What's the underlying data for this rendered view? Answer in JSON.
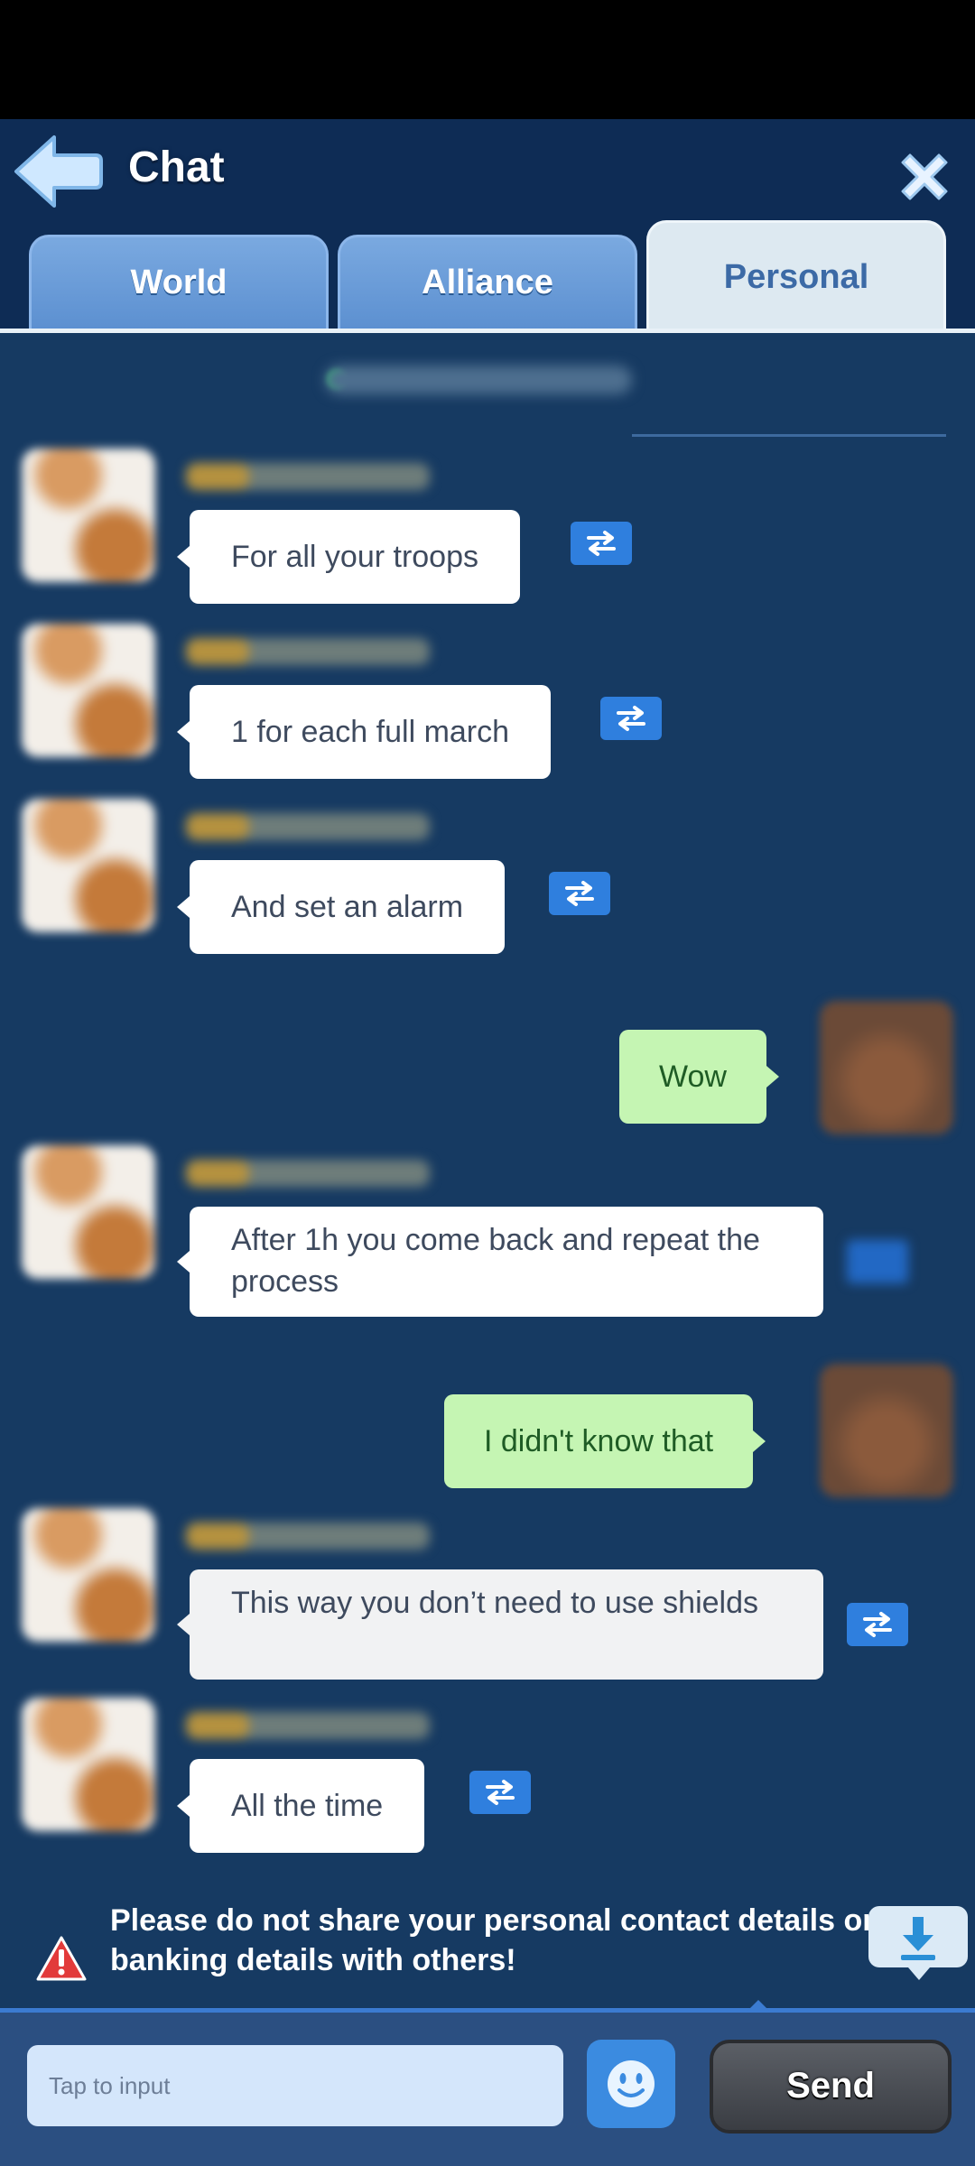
{
  "header": {
    "title": "Chat",
    "back_icon": "arrow-left-icon",
    "close_icon": "close-icon"
  },
  "tabs": [
    {
      "label": "World",
      "active": false
    },
    {
      "label": "Alliance",
      "active": false
    },
    {
      "label": "Personal",
      "active": true
    }
  ],
  "messages": [
    {
      "side": "other",
      "text": "For all your troops"
    },
    {
      "side": "other",
      "text": "1 for each full march"
    },
    {
      "side": "other",
      "text": "And set an alarm"
    },
    {
      "side": "self",
      "text": "Wow"
    },
    {
      "side": "other",
      "text": "After 1h you come back and repeat the process"
    },
    {
      "side": "self",
      "text": "I didn't know that"
    },
    {
      "side": "other",
      "text": "This way you don’t need to use shields"
    },
    {
      "side": "other",
      "text": "All the time"
    }
  ],
  "warning": {
    "text": "Please do not share your personal contact details or banking details with others!",
    "icon": "warning-icon"
  },
  "input": {
    "placeholder": "Tap to input",
    "send_label": "Send",
    "emoji_icon": "smiley-icon"
  },
  "colors": {
    "background": "#163a62",
    "header": "#0e2c55",
    "own_bubble": "#c5f5b3",
    "other_bubble": "#ffffff",
    "translate_button": "#2f7fde",
    "warning": "#e23a3a"
  }
}
